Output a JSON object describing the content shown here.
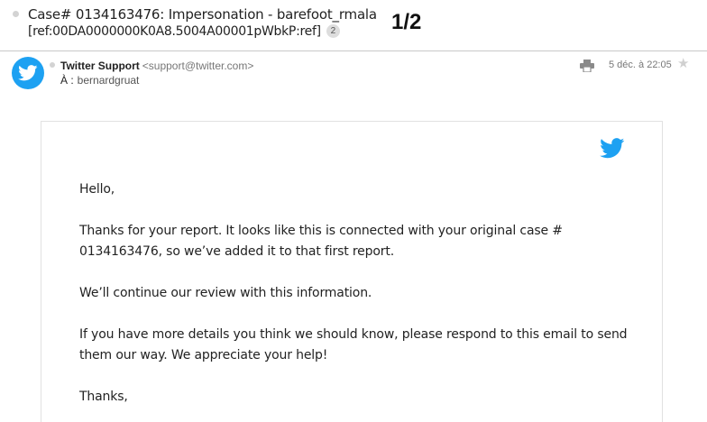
{
  "subject": {
    "line1": "Case# 0134163476: Impersonation - barefoot_rmala",
    "line2": "[ref:00DA0000000K0A8.5004A00001pWbkP:ref]",
    "thread_count": "2"
  },
  "page_indicator": "1/2",
  "message": {
    "sender_name": "Twitter Support",
    "sender_email": "<support@twitter.com>",
    "to_label": "À :",
    "to_value": "bernardgruat",
    "date": "5 déc. à 22:05",
    "icons": {
      "avatar": "twitter-bird-icon",
      "print": "printer-icon",
      "star": "star-icon"
    }
  },
  "email_body": {
    "greeting": "Hello,",
    "paragraph1": "Thanks for your report. It looks like this is connected with your original case # 0134163476, so we’ve added it to that first report.",
    "paragraph2": "We’ll continue our review with this information.",
    "paragraph3": "If you have more details you think we should know, please respond to this email to send them our way. We appreciate your help!",
    "closing": "Thanks,"
  },
  "colors": {
    "twitter_blue": "#1da1f2",
    "divider": "#c9c9c9"
  }
}
